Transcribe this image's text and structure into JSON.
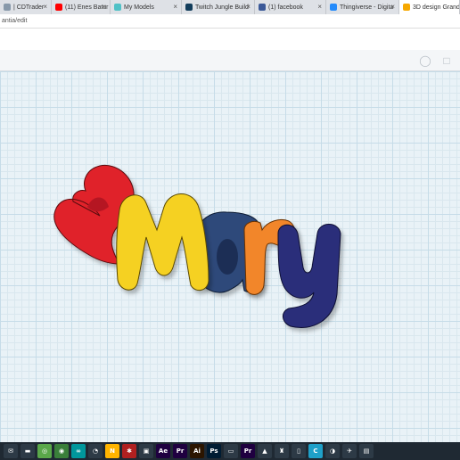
{
  "browser": {
    "tabs": [
      {
        "label": "| CDTrader",
        "favicon": "#8899aa",
        "icon": "page-icon"
      },
      {
        "label": "(11) Enes Batur - D",
        "favicon": "#ff0000",
        "icon": "youtube-icon"
      },
      {
        "label": "My Models",
        "favicon": "#4fc1c6",
        "icon": "thingiverse-icon"
      },
      {
        "label": "Twitch Jungle Build",
        "favicon": "#123d5b",
        "icon": "page-icon"
      },
      {
        "label": "(1) facebook",
        "favicon": "#3b5998",
        "icon": "facebook-icon"
      },
      {
        "label": "Thingiverse - Digita",
        "favicon": "#248bfb",
        "icon": "thingiverse-icon"
      },
      {
        "label": "3D design Grand St",
        "favicon": "#f6a800",
        "icon": "tinkercad-icon"
      }
    ],
    "close_symbol": "×",
    "url": "antia/edit"
  },
  "toolbar": {
    "icons": [
      "light-bulb-icon",
      "speech-bubble-icon"
    ]
  },
  "model": {
    "text": "Mary",
    "letters": [
      "M",
      "a",
      "r",
      "y"
    ],
    "colors": {
      "heart": "#e0202b",
      "M": "#f5d120",
      "a": "#2e4a7a",
      "r": "#f2862a",
      "y": "#2b2f7a"
    }
  },
  "taskbar": {
    "icons": [
      {
        "name": "mail-icon",
        "text": "✉",
        "bg": "#2d3a46"
      },
      {
        "name": "explorer-icon",
        "text": "▬",
        "bg": "#2d3a46"
      },
      {
        "name": "vpn-icon",
        "text": "◎",
        "bg": "#5aa84a"
      },
      {
        "name": "chrome-icon",
        "text": "◉",
        "bg": "#3a7f3a"
      },
      {
        "name": "arduino-icon",
        "text": "∞",
        "bg": "#00979c"
      },
      {
        "name": "clock-icon",
        "text": "◔",
        "bg": "#2d3a46"
      },
      {
        "name": "n-app-icon",
        "text": "N",
        "bg": "#ffb400"
      },
      {
        "name": "app-icon",
        "text": "✱",
        "bg": "#b02020"
      },
      {
        "name": "photo-app-icon",
        "text": "▣",
        "bg": "#2d3a46"
      },
      {
        "name": "after-effects-icon",
        "text": "Ae",
        "bg": "#1f0040"
      },
      {
        "name": "premiere-icon",
        "text": "Pr",
        "bg": "#1f0040"
      },
      {
        "name": "illustrator-icon",
        "text": "Ai",
        "bg": "#2c1500"
      },
      {
        "name": "photoshop-icon",
        "text": "Ps",
        "bg": "#001c33"
      },
      {
        "name": "monitor-icon",
        "text": "▭",
        "bg": "#2d3a46"
      },
      {
        "name": "premiere-pro-icon",
        "text": "Pr",
        "bg": "#1f0040"
      },
      {
        "name": "cone-icon",
        "text": "▲",
        "bg": "#2d3a46"
      },
      {
        "name": "game-icon",
        "text": "♜",
        "bg": "#2d3a46"
      },
      {
        "name": "file-icon",
        "text": "▯",
        "bg": "#2d3a46"
      },
      {
        "name": "c-app-icon",
        "text": "C",
        "bg": "#1fa0c8"
      },
      {
        "name": "blender-icon",
        "text": "◑",
        "bg": "#2d3a46"
      },
      {
        "name": "plane-icon",
        "text": "✈",
        "bg": "#2d3a46"
      },
      {
        "name": "store-icon",
        "text": "▤",
        "bg": "#2d3a46"
      }
    ]
  }
}
